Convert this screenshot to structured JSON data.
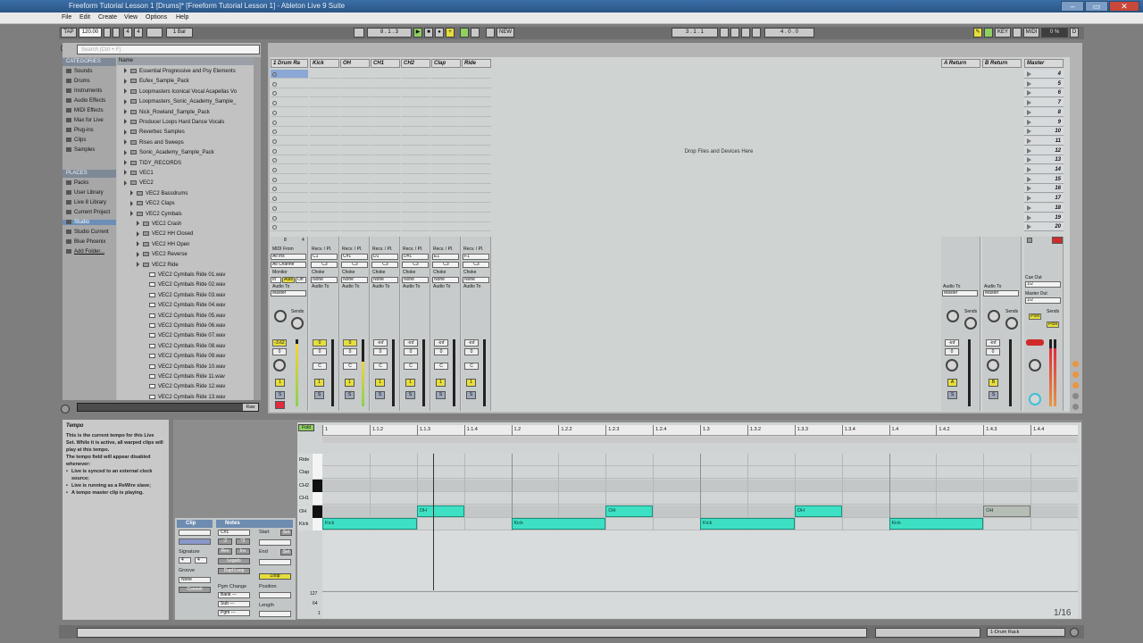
{
  "window": {
    "title": "Freeform Tutorial Lesson 1 [Drums]* [Freeform Tutorial Lesson 1] - Ableton Live 9 Suite",
    "minimize": "–",
    "maximize": "▭",
    "close": "✕"
  },
  "menu": [
    "File",
    "Edit",
    "Create",
    "View",
    "Options",
    "Help"
  ],
  "control_bar": {
    "tap": "TAP",
    "tempo": "120.00",
    "signature_num": "4",
    "signature_den": "4",
    "quantize": "1 Bar",
    "position": "8 . 1 . 3",
    "new_label": "NEW",
    "loop_start": "3 . 1 . 1",
    "loop_length": "4 . 0 . 0",
    "key_label": "KEY",
    "midi_label": "MIDI",
    "cpu": "0 %",
    "d_label": "D"
  },
  "browser": {
    "search_placeholder": "Search (Ctrl + F)",
    "categories_header": "CATEGORIES",
    "categories": [
      "Sounds",
      "Drums",
      "Instruments",
      "Audio Effects",
      "MIDI Effects",
      "Max for Live",
      "Plug-ins",
      "Clips",
      "Samples"
    ],
    "places_header": "PLACES",
    "places": [
      "Packs",
      "User Library",
      "Live 8 Library",
      "Current Project",
      "Studio",
      "Studio Current",
      "Blue Phoenix",
      "Add Folder..."
    ],
    "name_header": "Name",
    "items": [
      {
        "name": "Essential Progressive and Psy Elements",
        "level": 0,
        "type": "folder"
      },
      {
        "name": "Eufex_Sample_Pack",
        "level": 0,
        "type": "folder"
      },
      {
        "name": "Loopmasters Iconical Vocal Acapellas Vo",
        "level": 0,
        "type": "folder"
      },
      {
        "name": "Loopmasters_Sonic_Academy_Sample_",
        "level": 0,
        "type": "folder"
      },
      {
        "name": "Nick_Rowland_Sample_Pack",
        "level": 0,
        "type": "folder"
      },
      {
        "name": "Producer Loops Hard Dance Vocals",
        "level": 0,
        "type": "folder"
      },
      {
        "name": "Reverbec Samples",
        "level": 0,
        "type": "folder"
      },
      {
        "name": "Rises and Sweeps",
        "level": 0,
        "type": "folder"
      },
      {
        "name": "Sonic_Academy_Sample_Pack",
        "level": 0,
        "type": "folder"
      },
      {
        "name": "TIDY_RECORDS",
        "level": 0,
        "type": "folder"
      },
      {
        "name": "VEC1",
        "level": 0,
        "type": "folder"
      },
      {
        "name": "VEC2",
        "level": 0,
        "type": "folder"
      },
      {
        "name": "VEC2 Bassdrums",
        "level": 1,
        "type": "folder"
      },
      {
        "name": "VEC2 Claps",
        "level": 1,
        "type": "folder"
      },
      {
        "name": "VEC2 Cymbals",
        "level": 1,
        "type": "folder"
      },
      {
        "name": "VEC2 Crash",
        "level": 2,
        "type": "folder"
      },
      {
        "name": "VEC2 HH Closed",
        "level": 2,
        "type": "folder"
      },
      {
        "name": "VEC2 HH Open",
        "level": 2,
        "type": "folder"
      },
      {
        "name": "VEC2 Reverse",
        "level": 2,
        "type": "folder"
      },
      {
        "name": "VEC2 Ride",
        "level": 2,
        "type": "folder"
      },
      {
        "name": "VEC2 Cymbals Ride 01.wav",
        "level": 3,
        "type": "file"
      },
      {
        "name": "VEC2 Cymbals Ride 02.wav",
        "level": 3,
        "type": "file"
      },
      {
        "name": "VEC2 Cymbals Ride 03.wav",
        "level": 3,
        "type": "file"
      },
      {
        "name": "VEC2 Cymbals Ride 04.wav",
        "level": 3,
        "type": "file"
      },
      {
        "name": "VEC2 Cymbals Ride 05.wav",
        "level": 3,
        "type": "file"
      },
      {
        "name": "VEC2 Cymbals Ride 06.wav",
        "level": 3,
        "type": "file"
      },
      {
        "name": "VEC2 Cymbals Ride 07.wav",
        "level": 3,
        "type": "file"
      },
      {
        "name": "VEC2 Cymbals Ride 08.wav",
        "level": 3,
        "type": "file"
      },
      {
        "name": "VEC2 Cymbals Ride 09.wav",
        "level": 3,
        "type": "file"
      },
      {
        "name": "VEC2 Cymbals Ride 10.wav",
        "level": 3,
        "type": "file"
      },
      {
        "name": "VEC2 Cymbals Ride 11.wav",
        "level": 3,
        "type": "file"
      },
      {
        "name": "VEC2 Cymbals Ride 12.wav",
        "level": 3,
        "type": "file"
      },
      {
        "name": "VEC2 Cymbals Ride 13.wav",
        "level": 3,
        "type": "file"
      }
    ],
    "raw_label": "Raw"
  },
  "session": {
    "tracks": [
      "1 Drum Ra",
      "Kick",
      "OH",
      "CH1",
      "CH2",
      "Clap",
      "Ride"
    ],
    "returns": [
      "A Return",
      "B Return"
    ],
    "master": "Master",
    "scenes": [
      "4",
      "5",
      "6",
      "7",
      "8",
      "9",
      "10",
      "11",
      "12",
      "13",
      "14",
      "15",
      "16",
      "17",
      "18",
      "19",
      "20"
    ],
    "drop_message": "Drop Files and Devices Here",
    "midi_from": "MIDI From",
    "all_ins": "All Ins",
    "all_channels": "All Channe",
    "monitor": "Monitor",
    "monitor_in": "In",
    "monitor_auto": "Auto",
    "monitor_off": "Off",
    "audio_to": "Audio To",
    "master_out": "Master",
    "recv_label": "Recv. / Pl.",
    "pads": [
      "C1",
      "C#1",
      "D1",
      "D#1",
      "E1",
      "F1"
    ],
    "play_notes": [
      "C3",
      "C3",
      "C3",
      "C3",
      "C3",
      "C3"
    ],
    "choke": "Choke",
    "none": "None",
    "sends": "Sends",
    "cue_out": "Cue Out",
    "cue_out_val": "1/2",
    "master_out_label": "Master Out",
    "master_out_val": "1/2",
    "post": "Post",
    "drum_vol": "-3.62",
    "kick_vol": "0",
    "oh_vol": "0",
    "inf": "-inf",
    "zero": "0",
    "c": "C",
    "solo": "S",
    "return_a": "A",
    "return_b": "B",
    "track_num": "1",
    "num_8": "8",
    "num_4": "4"
  },
  "info": {
    "title": "Tempo",
    "body": "This is the current tempo for this Live Set. While it is active, all warped clips will play at this tempo.",
    "disabled_note": "The tempo field will appear disabled whenever:",
    "bullets": [
      "Live is synced to an external clock source;",
      "Live is running as a ReWire slave;",
      "A tempo master clip is playing."
    ]
  },
  "clip_panel": {
    "clip_header": "Clip",
    "notes_header": "Notes",
    "note_name": "C#1",
    "start_label": "Start",
    "end_label": "End",
    "set_label": "Set",
    "signature_label": "Signature",
    "sig_num": "4",
    "sig_den": "4",
    "groove_label": "Groove",
    "groove_val": "None",
    "commit_label": "Commit",
    "rev_label": "Rev",
    "inv_label": "Inv",
    "legato_label": "Legato",
    "dupl_label": "Dupl.Loop",
    "loop_label": "Loop",
    "pgm_change": "Pgm Change",
    "position_label": "Position",
    "length_label": "Length",
    "bank_label": "Bank ---",
    "sub_label": "Sub ---",
    "pgm_label": "Pgm ---",
    "half_label": ":2",
    "double_label": "*2"
  },
  "piano_roll": {
    "fold": "Fold",
    "ruler": [
      "1",
      "1.1.2",
      "1.1.3",
      "1.1.4",
      "1.2",
      "1.2.2",
      "1.2.3",
      "1.2.4",
      "1.3",
      "1.3.2",
      "1.3.3",
      "1.3.4",
      "1.4",
      "1.4.2",
      "1.4.3",
      "1.4.4"
    ],
    "keys": [
      "Ride",
      "Clap",
      "CH2",
      "CH1",
      "OH",
      "Kick"
    ],
    "notes": [
      {
        "key": "Kick",
        "start": 0,
        "length": 0.5,
        "label": "Kick",
        "dim": false
      },
      {
        "key": "OH",
        "start": 0.5,
        "length": 0.25,
        "label": "OH",
        "dim": false
      },
      {
        "key": "Kick",
        "start": 1,
        "length": 0.5,
        "label": "Kick",
        "dim": false
      },
      {
        "key": "OH",
        "start": 1.5,
        "length": 0.25,
        "label": "OH",
        "dim": false
      },
      {
        "key": "Kick",
        "start": 2,
        "length": 0.5,
        "label": "Kick",
        "dim": false
      },
      {
        "key": "OH",
        "start": 2.5,
        "length": 0.25,
        "label": "OH",
        "dim": false
      },
      {
        "key": "Kick",
        "start": 3,
        "length": 0.5,
        "label": "Kick",
        "dim": false
      },
      {
        "key": "OH",
        "start": 3.5,
        "length": 0.25,
        "label": "OH",
        "dim": true
      }
    ],
    "velocity_labels": [
      "127",
      "64",
      "1"
    ],
    "page": "1/16"
  },
  "status_bar": {
    "track": "1-Drum Rack"
  }
}
